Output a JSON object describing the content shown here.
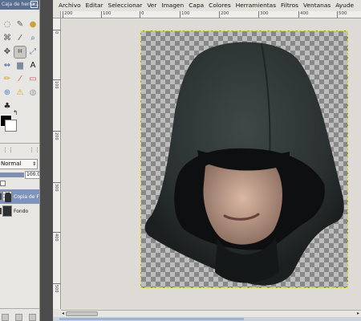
{
  "toolbox": {
    "title": "Caja de herra...",
    "close": "×",
    "tools": [
      {
        "name": "free-select-icon",
        "glyph": "◌",
        "color": "#6d6a65"
      },
      {
        "name": "fuzzy-select-icon",
        "glyph": "✎",
        "color": "#5a5853"
      },
      {
        "name": "color-picker-icon",
        "glyph": "●",
        "color": "#c9a23a"
      },
      {
        "name": "paths-icon",
        "glyph": "⌘",
        "color": "#555"
      },
      {
        "name": "eyedropper-icon",
        "glyph": "⁄",
        "color": "#333"
      },
      {
        "name": "zoom-icon",
        "glyph": "⌕",
        "color": "#2f5ea8"
      },
      {
        "name": "move-icon",
        "glyph": "✥",
        "color": "#444"
      },
      {
        "name": "crop-icon",
        "glyph": "⌗",
        "color": "#333"
      },
      {
        "name": "scale-icon",
        "glyph": "⤢",
        "color": "#5e7aa6"
      },
      {
        "name": "flip-icon",
        "glyph": "⇔",
        "color": "#3d5f9c"
      },
      {
        "name": "blend-icon",
        "glyph": "▆",
        "color": "#7f8c9f"
      },
      {
        "name": "text-icon",
        "glyph": "A",
        "color": "#111"
      },
      {
        "name": "pencil-icon",
        "glyph": "✏",
        "color": "#d59a2a"
      },
      {
        "name": "paintbrush-icon",
        "glyph": "⁄",
        "color": "#a55"
      },
      {
        "name": "eraser-icon",
        "glyph": "▭",
        "color": "#d24f52"
      },
      {
        "name": "clone-icon",
        "glyph": "⊕",
        "color": "#5b86c5"
      },
      {
        "name": "heal-icon",
        "glyph": "⚠",
        "color": "#d8a020"
      },
      {
        "name": "smudge-icon",
        "glyph": "◍",
        "color": "#9aa0a8"
      },
      {
        "name": "dodge-burn-icon",
        "glyph": "♣",
        "color": "#2a2a2a"
      }
    ],
    "swap_glyph": "↰",
    "layers_header": "⋮⋮",
    "mode_value": "Normal",
    "mode_dropdown": "⇕",
    "opacity_value": "100.0",
    "layers": [
      {
        "name": "Copia de F",
        "selected": true
      },
      {
        "name": "Fondo",
        "selected": false
      }
    ]
  },
  "image_window": {
    "menu": [
      "Archivo",
      "Editar",
      "Seleccionar",
      "Ver",
      "Imagen",
      "Capa",
      "Colores",
      "Herramientas",
      "Filtros",
      "Ventanas",
      "Ayude"
    ],
    "ruler_top": [
      "200",
      "100",
      "0",
      "100",
      "200",
      "300",
      "400",
      "500"
    ],
    "ruler_left": [
      "0",
      "100",
      "200",
      "300",
      "400",
      "500"
    ],
    "scroll_left": "◂",
    "scroll_right": "▸"
  },
  "colors": {
    "selection_border": "#e9e52a",
    "foreground": "#000000",
    "background": "#ffffff",
    "selected_layer": "#7e93b9"
  }
}
